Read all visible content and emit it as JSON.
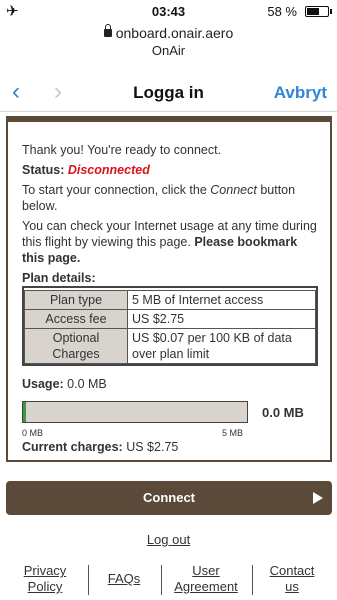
{
  "status_bar": {
    "airplane_icon": "airplane-icon",
    "time": "03:43",
    "battery_text": "58 %",
    "battery_level": 0.58
  },
  "url_bar": {
    "domain": "onboard.onair.aero",
    "site_name": "OnAir"
  },
  "nav": {
    "back_icon": "chevron-left-icon",
    "forward_icon": "chevron-right-icon",
    "title": "Logga in",
    "cancel_label": "Avbryt"
  },
  "main": {
    "ready_text": "Thank you! You're ready to connect.",
    "status_label": "Status:",
    "status_value": "Disconnected",
    "instruction_prefix": "To start your connection, click the ",
    "instruction_connect_word": "Connect",
    "instruction_suffix": " button below.",
    "check_usage_text": "You can check your Internet usage at any time during this flight by viewing this page. ",
    "bookmark_text": "Please bookmark this page.",
    "plan_details_label": "Plan details:",
    "plan_rows": [
      {
        "key": "Plan type",
        "value": "5 MB of Internet access"
      },
      {
        "key": "Access fee",
        "value": "US $2.75"
      },
      {
        "key": "Optional Charges",
        "value": "US $0.07 per 100 KB of data over plan limit"
      }
    ],
    "usage_label": "Usage:",
    "usage_value_text": "0.0 MB",
    "usage_fraction": 0.0,
    "usage_bar_min": "0 MB",
    "usage_bar_max": "5 MB",
    "usage_big_value": "0.0 MB",
    "current_charges_label": "Current charges:",
    "current_charges_value": "US $2.75"
  },
  "connect_button": {
    "label": "Connect",
    "icon": "play-icon"
  },
  "logout_label": "Log out",
  "footer": {
    "links": [
      {
        "line1": "Privacy",
        "line2": "Policy"
      },
      {
        "line1": "FAQs",
        "line2": ""
      },
      {
        "line1": "User",
        "line2": "Agreement"
      },
      {
        "line1": "Contact",
        "line2": "us"
      }
    ]
  },
  "colors": {
    "brand_brown": "#5b4a3a",
    "ios_blue": "#2f86d6",
    "status_red": "#d8131b",
    "usage_green": "#3c9a3c"
  }
}
